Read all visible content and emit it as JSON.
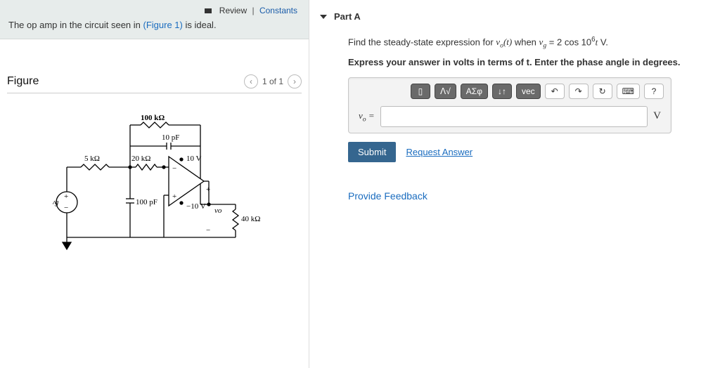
{
  "review": {
    "review_label": "Review",
    "constants_label": "Constants"
  },
  "problem": {
    "prefix": "The op amp in the circuit seen in ",
    "figure_link": "(Figure 1)",
    "suffix": " is ideal."
  },
  "figure": {
    "heading": "Figure",
    "pager_text": "1 of 1",
    "labels": {
      "r100k": "100 kΩ",
      "c10p": "10 pF",
      "r5k": "5 kΩ",
      "r20k": "20 kΩ",
      "vplus": "10 V",
      "vminus": "−10 V",
      "c100p": "100 pF",
      "vg": "vg",
      "vo": "vo",
      "r40k": "40 kΩ"
    }
  },
  "part": {
    "title": "Part A",
    "question_html": "Find the steady-state expression for <span class='expr'>v<sub>o</sub>(t)</span> when <span class='expr'>v<sub>g</sub></span> = 2 cos 10<sup>6</sup><span class='expr'>t</span> V.",
    "hint_html": "<b>Express your answer in volts in terms of <span class='expr'>t</span>. Enter the phase angle in degrees.</b>",
    "tools": {
      "template": "▯",
      "sqrt": "ᐱ√",
      "greek": "ΑΣφ",
      "arrows": "↓↑",
      "vec": "vec",
      "undo": "↶",
      "redo": "↷",
      "reset": "↻",
      "keyboard": "⌨",
      "help": "?"
    },
    "eq_label_html": "<span class='expr'>v<sub>o</sub></span> =",
    "unit": "V",
    "submit_label": "Submit",
    "request_label": "Request Answer"
  },
  "feedback_label": "Provide Feedback"
}
